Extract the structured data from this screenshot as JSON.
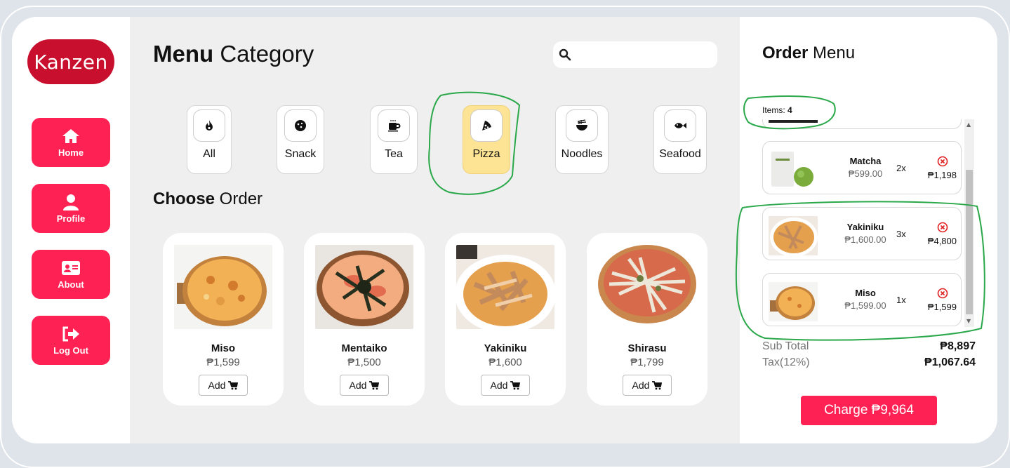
{
  "brand": {
    "logo_text": "Kanzen",
    "accent": "#fe2254",
    "logo_bg": "#c8102e"
  },
  "sidebar": {
    "items": [
      {
        "label": "Home",
        "icon": "home-icon"
      },
      {
        "label": "Profile",
        "icon": "user-icon"
      },
      {
        "label": "About",
        "icon": "id-card-icon"
      },
      {
        "label": "Log Out",
        "icon": "sign-out-icon"
      }
    ]
  },
  "main": {
    "title_bold": "Menu",
    "title_rest": " Category",
    "search": {
      "placeholder": ""
    },
    "categories": [
      {
        "label": "All",
        "icon": "fire-icon",
        "active": false
      },
      {
        "label": "Snack",
        "icon": "cookie-icon",
        "active": false
      },
      {
        "label": "Tea",
        "icon": "mug-icon",
        "active": false
      },
      {
        "label": "Pizza",
        "icon": "pizza-slice-icon",
        "active": true
      },
      {
        "label": "Noodles",
        "icon": "noodles-bowl-icon",
        "active": false
      },
      {
        "label": "Seafood",
        "icon": "fish-icon",
        "active": false
      }
    ],
    "choose_bold": "Choose",
    "choose_rest": " Order",
    "products": [
      {
        "name": "Miso",
        "price": "₱1,599",
        "add_label": "Add"
      },
      {
        "name": "Mentaiko",
        "price": "₱1,500",
        "add_label": "Add"
      },
      {
        "name": "Yakiniku",
        "price": "₱1,600",
        "add_label": "Add"
      },
      {
        "name": "Shirasu",
        "price": "₱1,799",
        "add_label": "Add"
      }
    ]
  },
  "order": {
    "title_bold": "Order",
    "title_rest": " Menu",
    "items_label": "Items: ",
    "items_count": "4",
    "items": [
      {
        "name": "Matcha",
        "unit_price": "₱599.00",
        "qty": "2x",
        "total": "₱1,198"
      },
      {
        "name": "Yakiniku",
        "unit_price": "₱1,600.00",
        "qty": "3x",
        "total": "₱4,800"
      },
      {
        "name": "Miso",
        "unit_price": "₱1,599.00",
        "qty": "1x",
        "total": "₱1,599"
      }
    ],
    "subtotal_label": "Sub Total",
    "subtotal_value": "₱8,897",
    "tax_label": "Tax(12%)",
    "tax_value": "₱1,067.64",
    "charge_label": "Charge ₱9,964"
  }
}
